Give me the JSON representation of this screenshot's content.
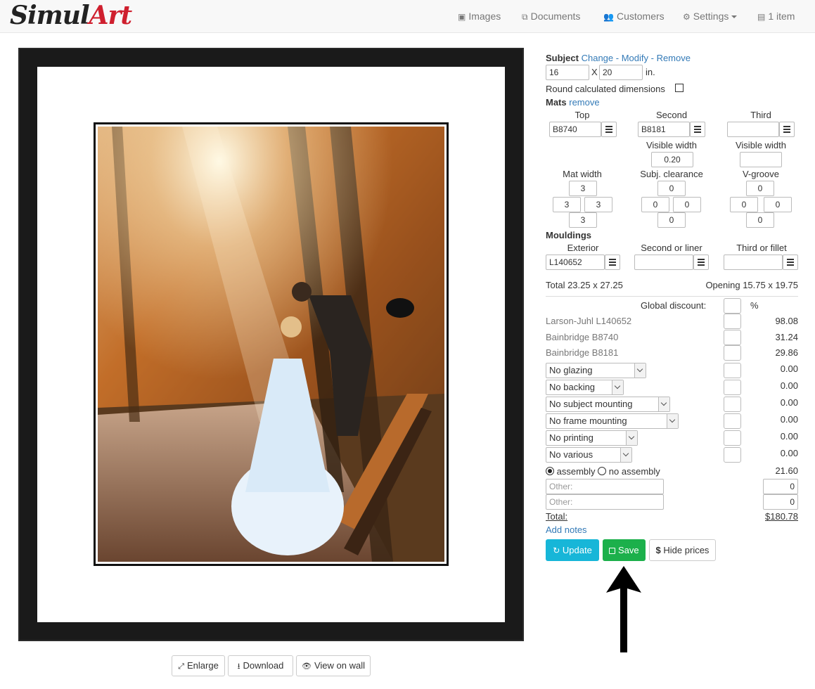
{
  "navbar": {
    "logo_part1": "Simul",
    "logo_part2": "Art",
    "items": [
      {
        "label": "Images",
        "icon": "image-icon"
      },
      {
        "label": "Documents",
        "icon": "documents-icon"
      },
      {
        "label": "Customers",
        "icon": "users-icon"
      },
      {
        "label": "Settings",
        "icon": "gear-icon"
      },
      {
        "label": "1 item",
        "icon": "file-icon"
      }
    ],
    "glyphs": [
      "▣",
      "⧉",
      "👥",
      "⚙",
      "▤"
    ]
  },
  "preview": {
    "buttons": [
      {
        "label": "Enlarge",
        "icon": "expand-icon",
        "glyph": "⤢"
      },
      {
        "label": "Download",
        "icon": "download-icon",
        "glyph": "⭳"
      },
      {
        "label": "View on wall",
        "icon": "eye-icon",
        "glyph": "👁"
      }
    ]
  },
  "subject": {
    "label": "Subject",
    "change": "Change",
    "sep1": " - ",
    "modify": "Modify",
    "sep2": " - ",
    "remove": "Remove",
    "width": "16",
    "x": "X",
    "height": "20",
    "unit": "in.",
    "round_label": "Round calculated dimensions",
    "round_checked": false
  },
  "mats": {
    "label": "Mats",
    "remove": "remove",
    "columns": [
      "Top",
      "Second",
      "Third"
    ],
    "codes": [
      "B8740",
      "B8181",
      ""
    ],
    "visible_width_label": "Visible width",
    "visible_width_values": [
      "0.20",
      ""
    ],
    "mat_width_label": "Mat width",
    "clearance_label": "Subj. clearance",
    "vgroove_label": "V-groove",
    "mat_width": {
      "top": "3",
      "left": "3",
      "right": "3",
      "bottom": "3"
    },
    "clearance": {
      "top": "0",
      "left": "0",
      "right": "0",
      "bottom": "0"
    },
    "vgroove": {
      "top": "0",
      "left": "0",
      "right": "0",
      "bottom": "0"
    }
  },
  "mouldings": {
    "label": "Mouldings",
    "columns": [
      "Exterior",
      "Second or liner",
      "Third or fillet"
    ],
    "codes": [
      "L140652",
      "",
      ""
    ]
  },
  "totals": {
    "total_label": "Total 23.25 x 27.25",
    "opening_label": "Opening 15.75 x 19.75"
  },
  "pricing": {
    "discount_label": "Global discount:",
    "discount_value": "",
    "percent": "%",
    "lines": [
      {
        "label": "Larson-Juhl L140652",
        "price": "98.08"
      },
      {
        "label": "Bainbridge B8740",
        "price": "31.24"
      },
      {
        "label": "Bainbridge B8181",
        "price": "29.86"
      }
    ],
    "selects": [
      {
        "value": "No glazing",
        "price": "0.00"
      },
      {
        "value": "No backing",
        "price": "0.00"
      },
      {
        "value": "No subject mounting",
        "price": "0.00"
      },
      {
        "value": "No frame mounting",
        "price": "0.00"
      },
      {
        "value": "No printing",
        "price": "0.00"
      },
      {
        "value": "No various",
        "price": "0.00"
      }
    ],
    "assembly_label": "assembly",
    "no_assembly_label": "no assembly",
    "assembly_selected": "assembly",
    "assembly_price": "21.60",
    "other_placeholder": "Other:",
    "other_values": [
      "0",
      "0"
    ],
    "total_label": "Total:",
    "total_value": "$180.78",
    "add_notes": "Add notes"
  },
  "actions": {
    "update": "Update",
    "save": "Save",
    "hide_prices": "Hide prices",
    "update_color": "#17b6d8",
    "save_color": "#1cb04b"
  }
}
